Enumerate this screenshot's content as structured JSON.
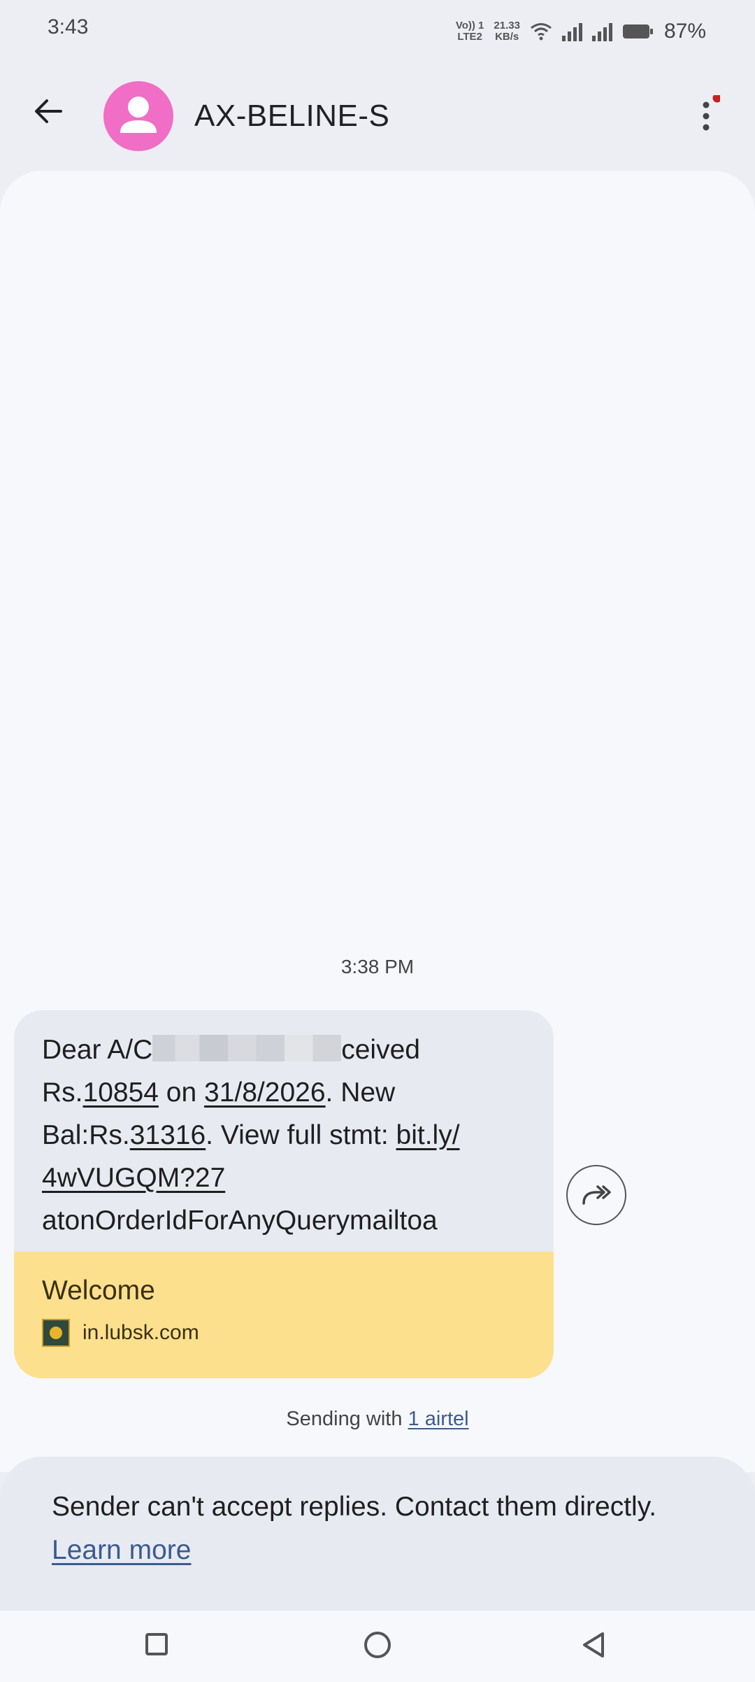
{
  "status_bar": {
    "time": "3:43",
    "network_top": "Vo)) 1",
    "network_bottom": "LTE2",
    "speed_value": "21.33",
    "speed_unit": "KB/s",
    "battery": "87%"
  },
  "header": {
    "contact_name": "AX-BELINE-S",
    "avatar_color": "#f06ec5",
    "notification_dot_color": "#c5221f"
  },
  "conversation": {
    "timestamp": "3:38 PM",
    "message": {
      "line1_start": "Dear A/C",
      "line1_end": "ceived",
      "rs_prefix": "Rs.",
      "amount": "10854",
      "on": " on ",
      "date": "31/8/2026",
      "new": ". New",
      "bal_prefix": "Bal:Rs.",
      "balance": "31316",
      "view": ". View full stmt: ",
      "link_part1": "bit.ly/",
      "link_part2": "4wVUGQM?27",
      "line5": "atonOrderIdForAnyQuerymailtoa"
    },
    "preview": {
      "title": "Welcome",
      "domain": "in.lubsk.com",
      "background": "#fde08e"
    },
    "sending_prefix": "Sending with ",
    "sim_label": "1 airtel"
  },
  "reply_notice": {
    "text": "Sender can't accept replies. Contact them directly.",
    "learn_more": "Learn more"
  }
}
